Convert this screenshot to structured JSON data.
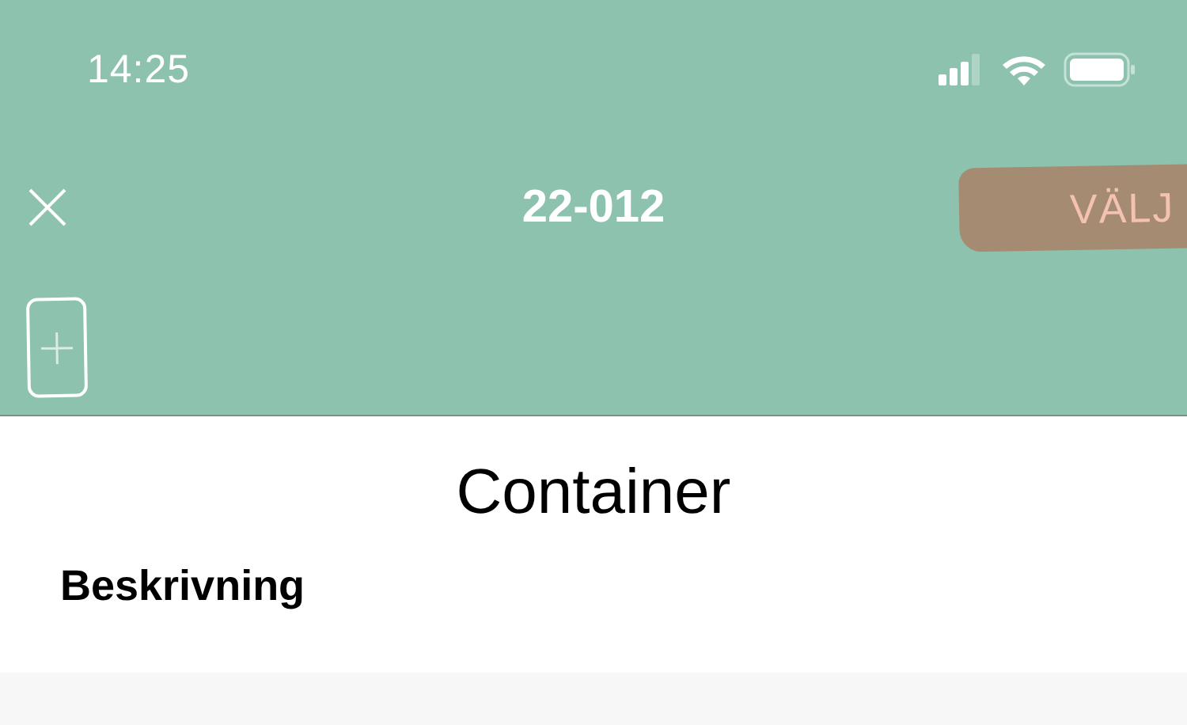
{
  "status_bar": {
    "time": "14:25"
  },
  "nav": {
    "title": "22-012",
    "action": "VÄLJ"
  },
  "page": {
    "title": "Container",
    "section": "Beskrivning"
  }
}
